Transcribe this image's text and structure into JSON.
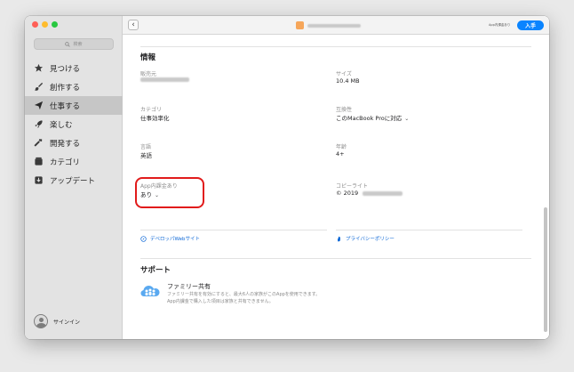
{
  "sidebar": {
    "search_placeholder": "検索",
    "items": [
      {
        "label": "見つける",
        "icon": "star-icon"
      },
      {
        "label": "創作する",
        "icon": "brush-icon"
      },
      {
        "label": "仕事する",
        "icon": "paper-plane-icon"
      },
      {
        "label": "楽しむ",
        "icon": "rocket-icon"
      },
      {
        "label": "開発する",
        "icon": "hammer-icon"
      },
      {
        "label": "カテゴリ",
        "icon": "category-box-icon"
      },
      {
        "label": "アップデート",
        "icon": "update-download-icon"
      }
    ],
    "active_index": 2,
    "signin_label": "サインイン"
  },
  "toolbar": {
    "back_label": "‹",
    "iap_note": "App内課金あり",
    "get_label": "入手"
  },
  "info": {
    "title": "情報",
    "fields": {
      "seller_label": "販売元",
      "size_label": "サイズ",
      "size_value": "10.4 MB",
      "category_label": "カテゴリ",
      "category_value": "仕事効率化",
      "compat_label": "互換性",
      "compat_value": "このMacBook Proに対応",
      "language_label": "言語",
      "language_value": "英語",
      "age_label": "年齢",
      "age_value": "4+",
      "iap_label": "App内課金あり",
      "iap_value": "あり",
      "copyright_label": "コピーライト",
      "copyright_value": "© 2019"
    }
  },
  "links": {
    "developer_site": "デベロッパWebサイト",
    "privacy_policy": "プライバシーポリシー"
  },
  "support": {
    "title": "サポート",
    "family_title": "ファミリー共有",
    "family_desc": "ファミリー共有を有効にすると、最大6人の家族がこのAppを使用できます。App内課金で購入した項目は家族と共有できません。"
  },
  "colors": {
    "accent": "#0a84ff",
    "highlight": "#e11b1b",
    "sidebar_bg": "#e3e3e3",
    "active_item_bg": "#c6c6c6"
  }
}
